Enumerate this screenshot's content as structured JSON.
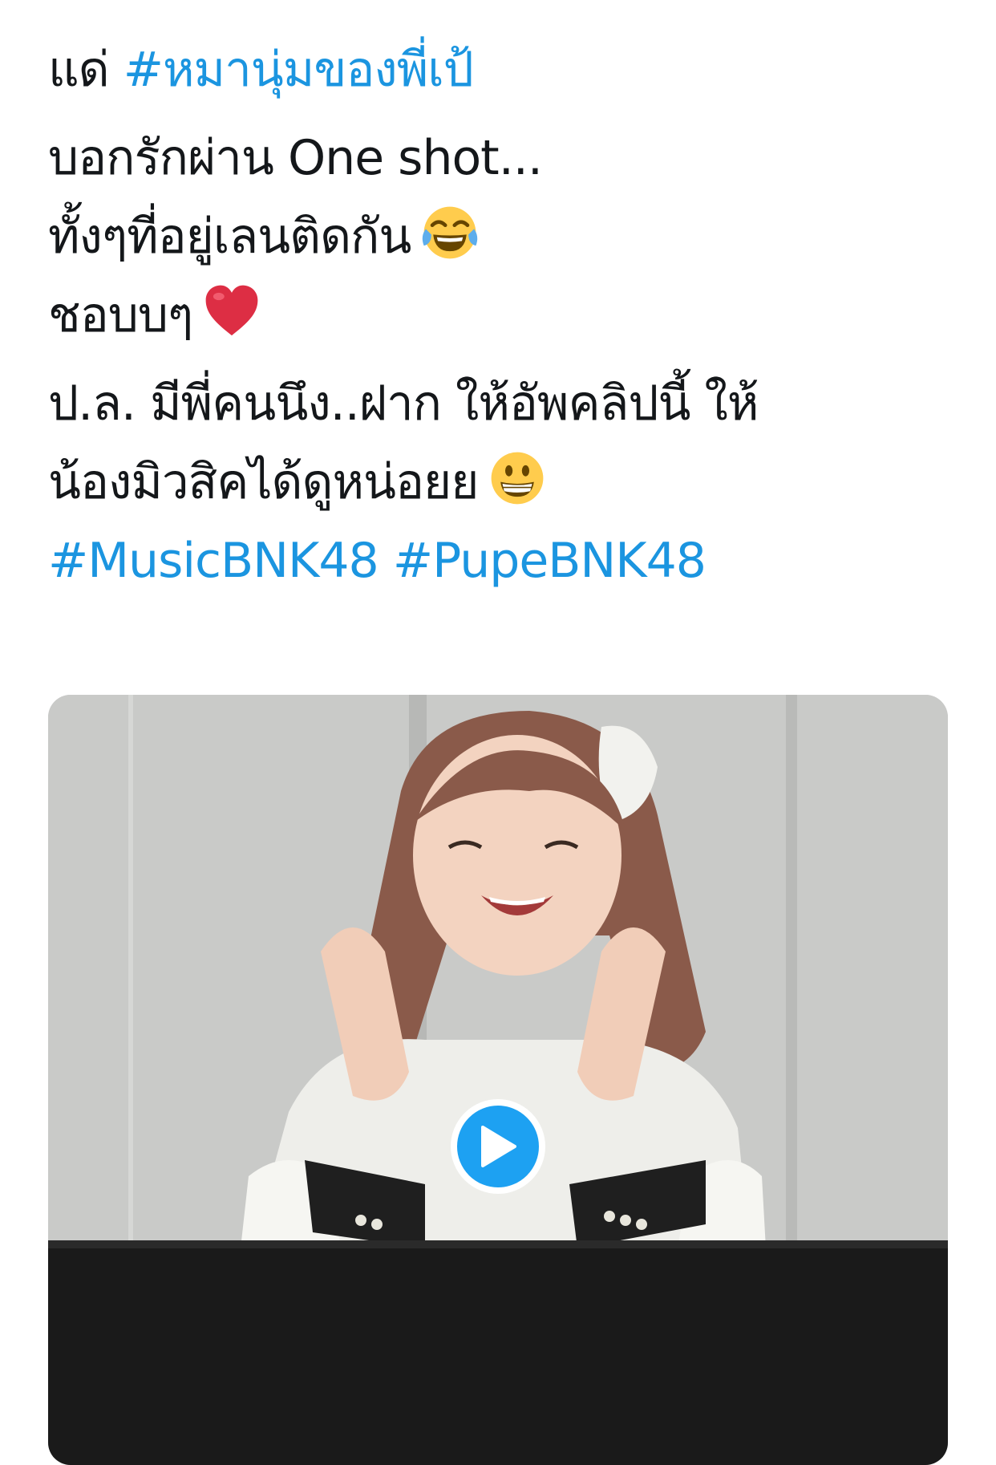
{
  "tweet": {
    "line1_prefix": "แด่ ",
    "line1_hashtag": "#หมานุ่มของพี่เป้",
    "line2": "บอกรักผ่าน One shot...",
    "line3": "ทั้งๆที่อยู่เลนติดกัน",
    "line3_emoji": "face-with-tears-of-joy-emoji",
    "line4": "ชอบบๆ",
    "line4_emoji": "red-heart-emoji",
    "line5": "ป.ล. มีพี่คนนึง..ฝาก ให้อัพคลิปนี้ ให้",
    "line6": "น้องมิวสิคได้ดูหน่อยย",
    "line6_emoji": "grinning-face-emoji",
    "hashtags": [
      "#MusicBNK48",
      "#PupeBNK48"
    ]
  },
  "media": {
    "type": "video",
    "play_icon": "play-icon",
    "accent_color": "#1da1f2"
  },
  "colors": {
    "hashtag": "#1b95e0",
    "text": "#14171a"
  }
}
